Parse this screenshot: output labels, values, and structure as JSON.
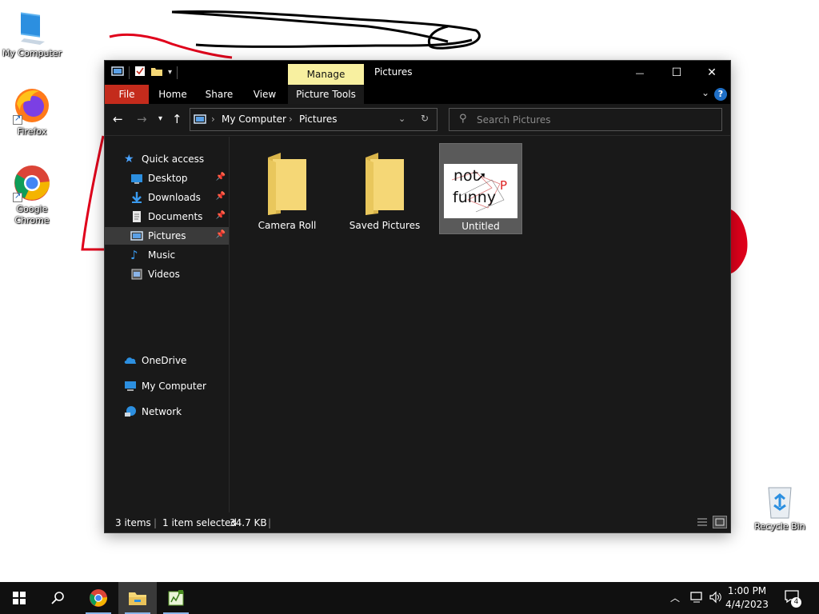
{
  "desktop": {
    "icons": [
      {
        "label": "My Computer",
        "icon": "computer-icon"
      },
      {
        "label": "Firefox",
        "icon": "firefox-icon"
      },
      {
        "label": "Google Chrome",
        "icon": "chrome-icon"
      },
      {
        "label": "Recycle Bin",
        "icon": "recycle-bin-icon"
      }
    ],
    "scribble_colors": {
      "black": "#000000",
      "red": "#e0001b"
    }
  },
  "window": {
    "title": "Pictures",
    "contextual_tab": "Manage",
    "ribbon_tabs": [
      "File",
      "Home",
      "Share",
      "View",
      "Picture Tools"
    ],
    "controls": {
      "minimize": "—",
      "maximize": "☐",
      "close": "✕"
    },
    "address": {
      "root": "My Computer",
      "current": "Pictures"
    },
    "search": {
      "placeholder": "Search Pictures"
    },
    "sidebar": [
      {
        "label": "Quick access",
        "icon": "star-icon"
      },
      {
        "label": "Desktop",
        "icon": "desktop-icon",
        "pinned": true
      },
      {
        "label": "Downloads",
        "icon": "download-icon",
        "pinned": true
      },
      {
        "label": "Documents",
        "icon": "document-icon",
        "pinned": true
      },
      {
        "label": "Pictures",
        "icon": "pictures-icon",
        "pinned": true,
        "selected": true
      },
      {
        "label": "Music",
        "icon": "music-icon"
      },
      {
        "label": "Videos",
        "icon": "video-icon"
      },
      {
        "label": "OneDrive",
        "icon": "cloud-icon"
      },
      {
        "label": "My Computer",
        "icon": "computer-icon"
      },
      {
        "label": "Network",
        "icon": "network-icon"
      }
    ],
    "items": [
      {
        "name": "Camera Roll",
        "type": "folder"
      },
      {
        "name": "Saved Pictures",
        "type": "folder"
      },
      {
        "name": "Untitled",
        "type": "image",
        "selected": true,
        "thumb_text_1": "not",
        "thumb_text_2": "funny",
        "thumb_text_3": "P"
      }
    ],
    "status": {
      "count": "3 items",
      "selection": "1 item selected",
      "size": "34.7 KB"
    },
    "colors": {
      "file_tab": "#c42b1c",
      "manage_tab": "#f8f0a0",
      "folder": "#f5d776"
    }
  },
  "taskbar": {
    "time": "1:00 PM",
    "date": "4/4/2023",
    "notification_count": "4",
    "apps": [
      "chrome-icon",
      "file-explorer-icon",
      "editor-icon"
    ]
  }
}
